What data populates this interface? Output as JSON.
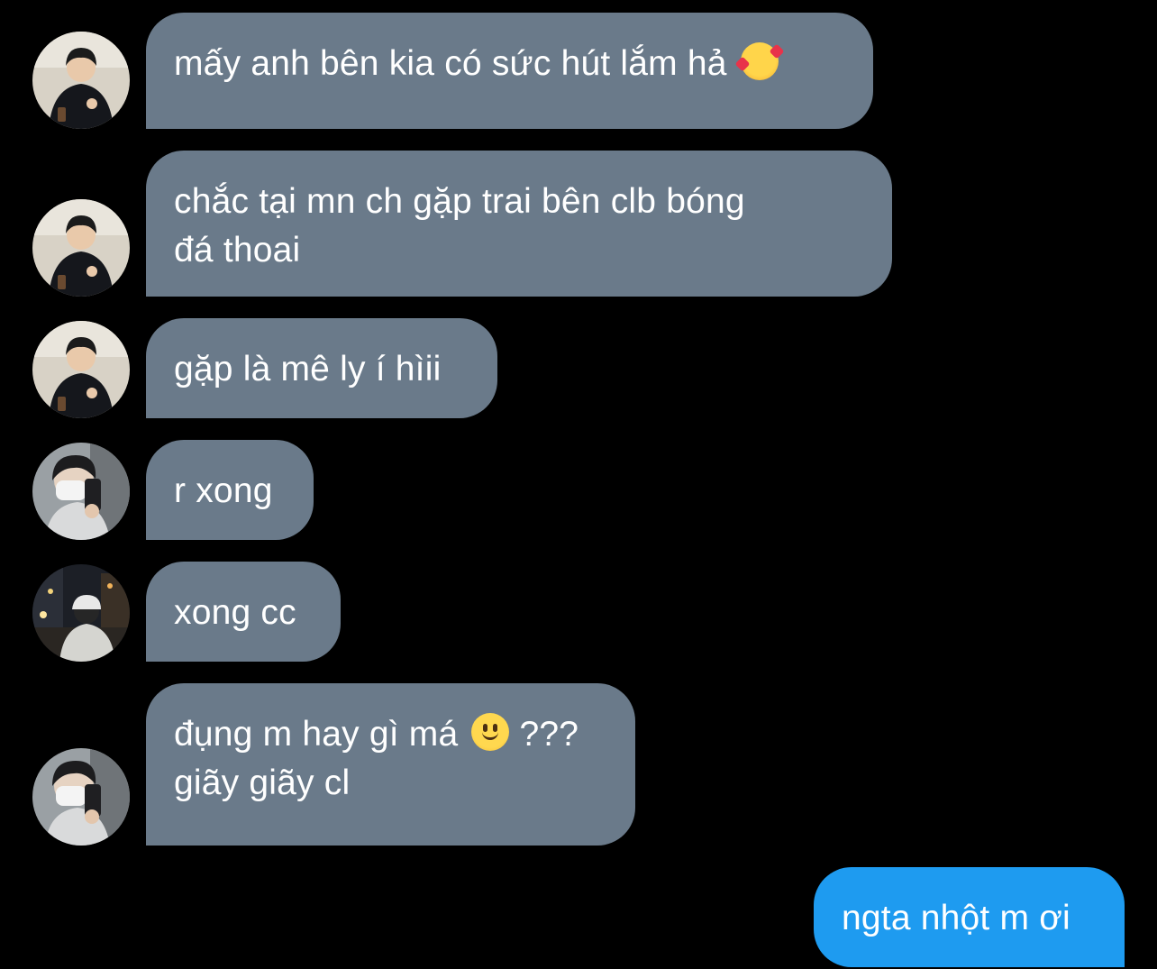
{
  "messages": [
    {
      "sender": "other",
      "avatar": "avatar-hoodie-guy",
      "text": "mấy anh bên kia có sức hút lắm hả",
      "emoji": "smiling-face-with-hearts"
    },
    {
      "sender": "other",
      "avatar": "avatar-hoodie-guy",
      "text": "chắc tại mn ch gặp trai bên clb bóng\nđá thoai"
    },
    {
      "sender": "other",
      "avatar": "avatar-hoodie-guy",
      "text": "gặp là mê ly í hìii"
    },
    {
      "sender": "other",
      "avatar": "avatar-mask-mirror-selfie",
      "text": "r xong"
    },
    {
      "sender": "other",
      "avatar": "avatar-night-street",
      "text": "xong cc"
    },
    {
      "sender": "other",
      "avatar": "avatar-mask-mirror-selfie",
      "text_line1": "đụng m hay gì má",
      "emoji": "slightly-smiling-face",
      "text_line1_suffix": " ???",
      "text_line2": "giãy giãy cl"
    },
    {
      "sender": "me",
      "text": "ngta nhột m ơi"
    }
  ],
  "colors": {
    "background": "#000000",
    "incoming_bubble": "#6a7a8a",
    "outgoing_bubble": "#1e9bf0",
    "text": "#ffffff"
  }
}
